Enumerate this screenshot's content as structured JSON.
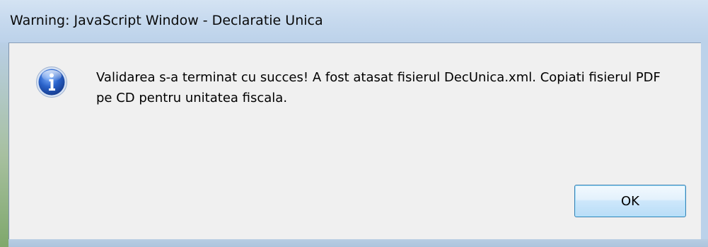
{
  "dialog": {
    "title": "Warning: JavaScript Window - Declaratie Unica",
    "icon": "information-icon",
    "message": "Validarea s-a terminat cu succes! A fost atasat fisierul DecUnica.xml. Copiati fisierul PDF pe CD pentru unitatea fiscala.",
    "ok_label": "OK"
  },
  "colors": {
    "titlebar": "#c6d9ee",
    "client": "#f0f0f0",
    "icon_blue": "#2a62c9",
    "button_border": "#3c7fb1"
  }
}
